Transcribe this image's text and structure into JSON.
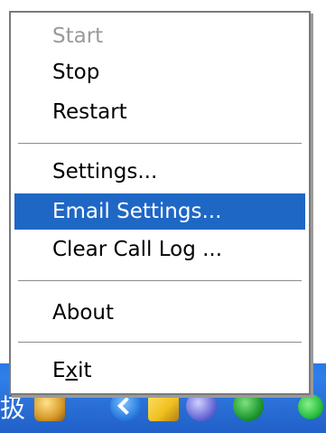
{
  "taskbar": {
    "ime_glyph": "扱",
    "tray_icons": [
      "printer-icon",
      "back-arrow-icon",
      "folder-icon",
      "globe-icon",
      "green-status-icon",
      "green-status-icon"
    ]
  },
  "menu": {
    "items": [
      {
        "label": "Start",
        "enabled": false
      },
      {
        "label": "Stop",
        "enabled": true
      },
      {
        "label": "Restart",
        "enabled": true
      },
      {
        "label": "Settings...",
        "enabled": true
      },
      {
        "label": "Email Settings...",
        "enabled": true,
        "highlighted": true
      },
      {
        "label": "Clear Call Log ...",
        "enabled": true
      },
      {
        "label": "About",
        "enabled": true
      },
      {
        "label_prefix": "E",
        "label_accel": "x",
        "label_suffix": "it",
        "enabled": true
      }
    ]
  },
  "colors": {
    "highlight": "#1f67c5",
    "disabled_text": "#9a9a9a",
    "taskbar": "#2b78e4"
  }
}
